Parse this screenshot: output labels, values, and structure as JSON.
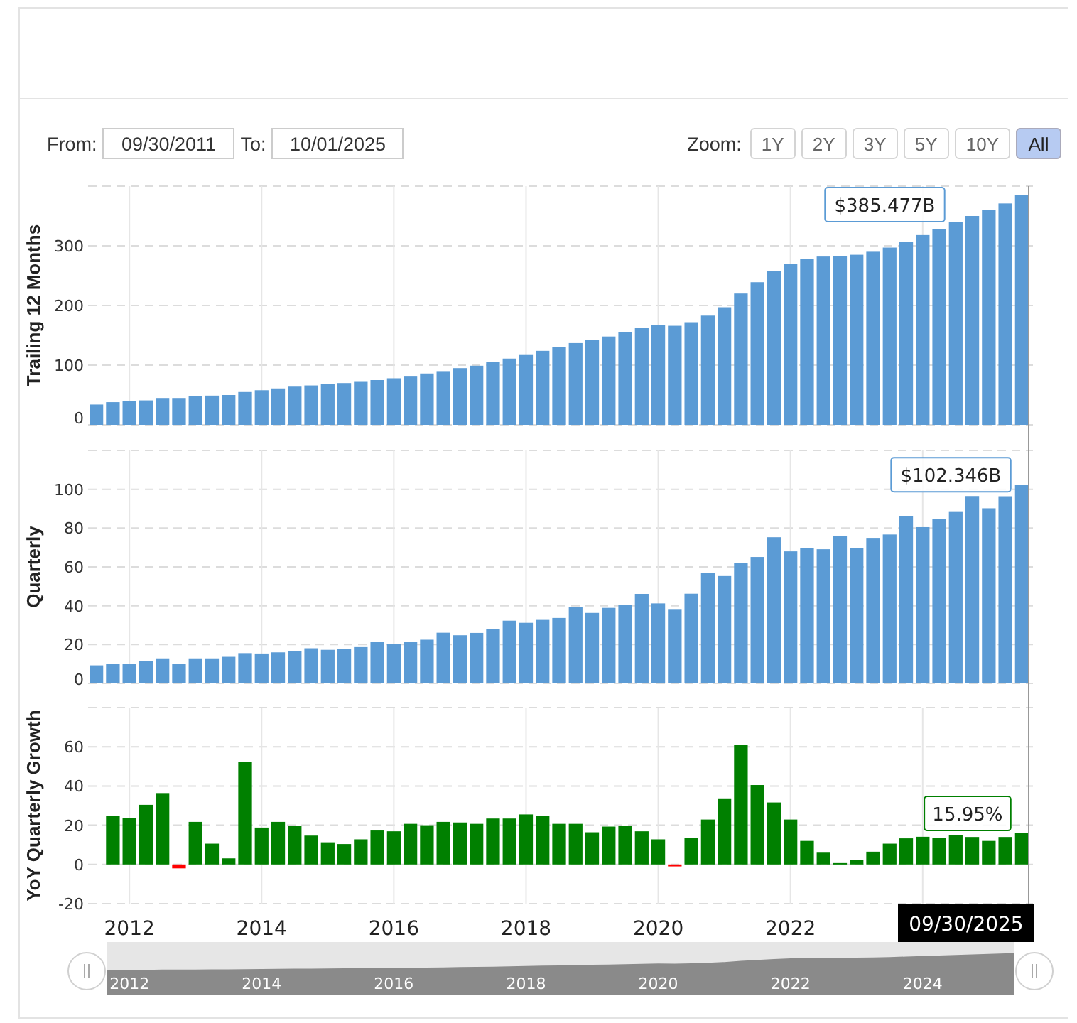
{
  "date_range": {
    "from_label": "From:",
    "from": "09/30/2011",
    "to_label": "To:",
    "to": "10/01/2025"
  },
  "zoom": {
    "label": "Zoom:",
    "buttons": [
      {
        "label": "1Y",
        "selected": false
      },
      {
        "label": "2Y",
        "selected": false
      },
      {
        "label": "3Y",
        "selected": false
      },
      {
        "label": "5Y",
        "selected": false
      },
      {
        "label": "10Y",
        "selected": false
      },
      {
        "label": "All",
        "selected": true
      }
    ]
  },
  "panels": [
    {
      "tooltip": "$385.477B",
      "chart_data": {
        "type": "bar",
        "ylabel": "Trailing 12 Months",
        "ylim": [
          0,
          400
        ],
        "yticks": [
          0,
          100,
          200,
          300
        ],
        "grid": true,
        "series": [
          {
            "color": "#5b9bd5",
            "values": [
              34,
              38,
              40,
              41,
              45,
              45,
              48,
              49,
              50,
              55,
              58,
              61,
              64,
              66,
              68,
              70,
              72,
              75,
              78,
              82,
              86,
              90,
              95,
              99,
              105,
              111,
              117,
              124,
              130,
              137,
              142,
              148,
              155,
              162,
              167,
              166,
              172,
              183,
              197,
              220,
              239,
              258,
              270,
              278,
              282,
              283,
              285,
              290,
              297,
              307,
              318,
              328,
              340,
              350,
              360,
              371,
              385
            ]
          }
        ]
      }
    },
    {
      "tooltip": "$102.346B",
      "chart_data": {
        "type": "bar",
        "ylabel": "Quarterly",
        "ylim": [
          0,
          120
        ],
        "yticks": [
          0,
          20,
          40,
          60,
          80,
          100
        ],
        "grid": true,
        "series": [
          {
            "color": "#5b9bd5",
            "values": [
              9.3,
              10.2,
              10.2,
              11.5,
              12.9,
              10.2,
              12.9,
              12.9,
              13.7,
              15.6,
              15.4,
              16,
              16.5,
              18.1,
              17.3,
              17.7,
              18.7,
              21.3,
              20.3,
              21.5,
              22.5,
              26.1,
              24.8,
              26,
              27.8,
              32.3,
              31.2,
              32.7,
              33.7,
              39.3,
              36.3,
              38.9,
              40.5,
              46.1,
              41.2,
              38.3,
              46.2,
              56.9,
              55.3,
              61.9,
              65.1,
              75.3,
              68,
              69.7,
              69.1,
              76.1,
              69.8,
              74.6,
              76.7,
              86.3,
              80.5,
              84.7,
              88.3,
              96.5,
              90.2,
              96.4,
              102.3
            ]
          }
        ]
      }
    },
    {
      "tooltip": "15.95%",
      "chart_data": {
        "type": "bar",
        "ylabel": "YoY Quarterly Growth",
        "ylim": [
          -20,
          80
        ],
        "yticks": [
          -20,
          0,
          20,
          40,
          60
        ],
        "grid": true,
        "stacked": true,
        "xlim": [
          2011.375,
          2025.625
        ],
        "xticks": [
          2012,
          2014,
          2016,
          2018,
          2020,
          2022
        ],
        "x": [
          2011.75,
          2012,
          2012.25,
          2012.5,
          2012.75,
          2013,
          2013.25,
          2013.5,
          2013.75,
          2014,
          2014.25,
          2014.5,
          2014.75,
          2015,
          2015.25,
          2015.5,
          2015.75,
          2016,
          2016.25,
          2016.5,
          2016.75,
          2017,
          2017.25,
          2017.5,
          2017.75,
          2018,
          2018.25,
          2018.5,
          2018.75,
          2019,
          2019.25,
          2019.5,
          2019.75,
          2020,
          2020.25,
          2020.5,
          2020.75,
          2021,
          2021.25,
          2021.5,
          2021.75,
          2022,
          2022.25,
          2022.5,
          2022.75,
          2023,
          2023.25,
          2023.5,
          2023.75,
          2024,
          2024.25,
          2024.5,
          2024.75,
          2025,
          2025.25,
          2025.5
        ],
        "series": [
          {
            "color": "#008000",
            "values": [
              24.8,
              23.6,
              30.4,
              36.4,
              null,
              21.7,
              10.6,
              3.1,
              52.3,
              18.8,
              21.7,
              19.5,
              14.7,
              11.3,
              10.4,
              12.8,
              17.3,
              16.9,
              20.7,
              20,
              21.7,
              21.4,
              20.7,
              23.4,
              23.4,
              25.5,
              24.8,
              20.7,
              20.7,
              16.4,
              19.3,
              19.5,
              16.9,
              12.8,
              null,
              13.5,
              22.9,
              33.7,
              61,
              40.5,
              31.6,
              22.9,
              12,
              6,
              0.7,
              2.4,
              6.5,
              10.6,
              13.3,
              14.1,
              13.6,
              15.1,
              14,
              12,
              14,
              16
            ]
          },
          {
            "color": "#ff0000",
            "values": [
              null,
              null,
              null,
              null,
              -2,
              null,
              null,
              null,
              null,
              null,
              null,
              null,
              null,
              null,
              null,
              null,
              null,
              null,
              null,
              null,
              null,
              null,
              null,
              null,
              null,
              null,
              null,
              null,
              null,
              null,
              null,
              null,
              null,
              null,
              -1,
              null,
              null,
              null,
              null,
              null,
              null,
              null,
              null,
              null,
              null,
              null,
              null,
              null,
              null,
              null,
              null,
              null,
              null,
              null,
              null,
              null
            ]
          }
        ]
      }
    }
  ],
  "crosshair_date": "09/30/2025",
  "navigator": {
    "labels": [
      "2012",
      "2014",
      "2016",
      "2018",
      "2020",
      "2022",
      "2024"
    ]
  }
}
